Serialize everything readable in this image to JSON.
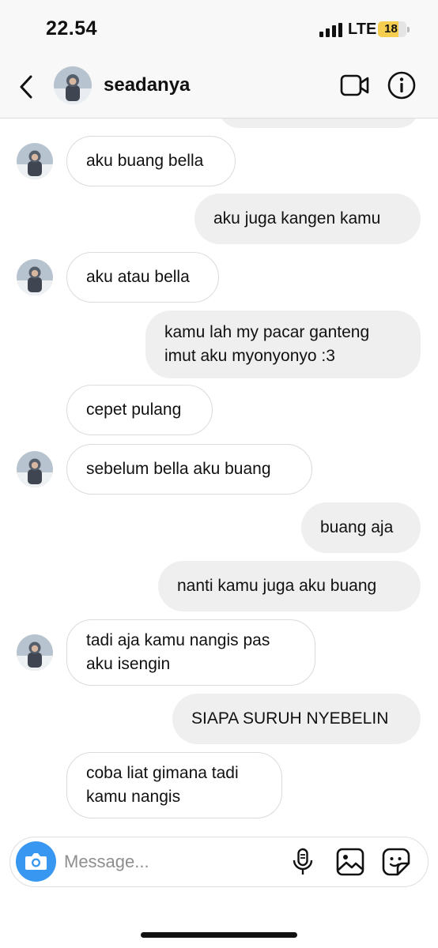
{
  "status_bar": {
    "time": "22.54",
    "network": "LTE",
    "battery": "18"
  },
  "header": {
    "username": "seadanya"
  },
  "messages": [
    {
      "side": "in",
      "text": "aku buang bella",
      "avatar": true
    },
    {
      "side": "out",
      "text": "aku juga kangen kamu"
    },
    {
      "side": "in",
      "text": "aku atau bella",
      "avatar": true
    },
    {
      "side": "out",
      "text": "kamu lah my pacar ganteng\nimut aku myonyonyo :3"
    },
    {
      "side": "in",
      "text": "cepet pulang",
      "avatar": false
    },
    {
      "side": "in",
      "text": "sebelum bella aku buang",
      "avatar": true
    },
    {
      "side": "out",
      "text": "buang aja"
    },
    {
      "side": "out",
      "text": "nanti kamu juga aku buang"
    },
    {
      "side": "in",
      "text": "tadi aja kamu nangis pas\naku isengin",
      "avatar": true
    },
    {
      "side": "out",
      "text": "SIAPA SURUH NYEBELIN"
    },
    {
      "side": "in",
      "text": "coba liat gimana tadi\nkamu nangis",
      "avatar": false
    }
  ],
  "composer": {
    "placeholder": "Message..."
  },
  "icons": {
    "back": "chevron-left-icon",
    "video": "video-camera-icon",
    "info": "info-icon",
    "camera": "camera-icon",
    "mic": "microphone-icon",
    "gallery": "gallery-icon",
    "sticker": "sticker-icon"
  },
  "colors": {
    "accent": "#3897f0",
    "incoming_border": "#dbdbdb",
    "outgoing_bg": "#efefef",
    "battery": "#f5cd4f"
  }
}
